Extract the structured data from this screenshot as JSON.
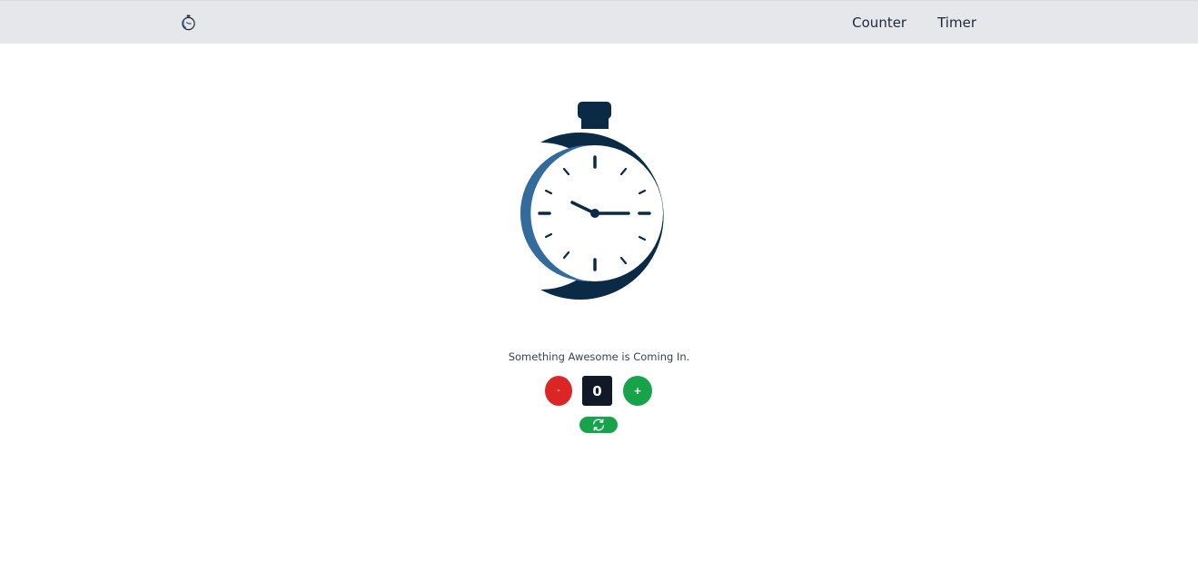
{
  "nav": {
    "logo_icon": "stopwatch-icon",
    "links": [
      {
        "label": "Counter"
      },
      {
        "label": "Timer"
      }
    ]
  },
  "hero": {
    "illustration_icon": "stopwatch-icon",
    "colors": {
      "dark": "#0b2a45",
      "accent": "#336b9c"
    }
  },
  "main": {
    "tagline": "Something Awesome is Coming In."
  },
  "counter": {
    "decrement_label": "-",
    "value": "0",
    "increment_label": "+",
    "reset_icon": "refresh-icon",
    "colors": {
      "decrement": "#dc2626",
      "increment": "#16a34a",
      "value_bg": "#111827",
      "reset": "#16a34a"
    }
  }
}
